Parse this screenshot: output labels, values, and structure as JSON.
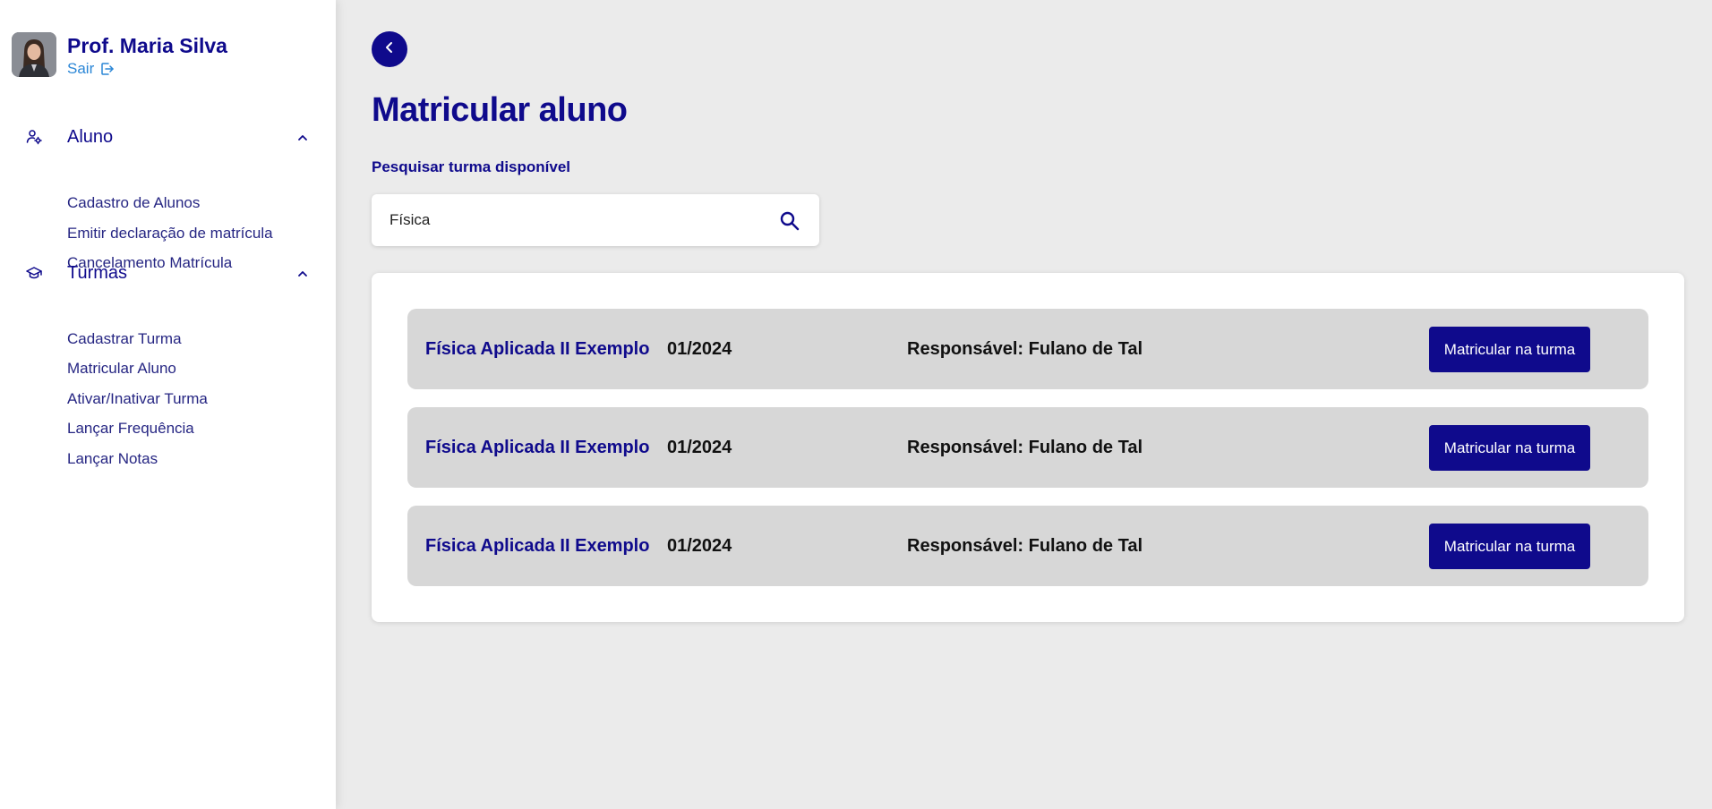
{
  "profile": {
    "name": "Prof. Maria Silva",
    "logout_label": "Sair",
    "avatar_icon": "avatar-photo",
    "logout_icon": "logout-icon"
  },
  "sidebar": {
    "sections": [
      {
        "label": "Aluno",
        "icon": "student-settings-icon",
        "expanded": true,
        "items": [
          {
            "label": "Cadastro de Alunos"
          },
          {
            "label": "Emitir declaração de matrícula"
          },
          {
            "label": "Cancelamento Matrícula"
          }
        ]
      },
      {
        "label": "Turmas",
        "icon": "graduation-cap-icon",
        "expanded": true,
        "items": [
          {
            "label": "Cadastrar Turma"
          },
          {
            "label": "Matricular Aluno"
          },
          {
            "label": "Ativar/Inativar Turma"
          },
          {
            "label": "Lançar Frequência"
          },
          {
            "label": "Lançar Notas"
          }
        ]
      }
    ]
  },
  "main": {
    "title": "Matricular aluno",
    "back_icon": "chevron-left-icon",
    "search": {
      "label": "Pesquisar turma disponível",
      "value": "Física",
      "placeholder": "",
      "icon": "search-icon"
    },
    "results": [
      {
        "name": "Física Aplicada II Exemplo",
        "period": "01/2024",
        "owner": "Responsável: Fulano de Tal",
        "action": "Matricular na turma"
      },
      {
        "name": "Física Aplicada II Exemplo",
        "period": "01/2024",
        "owner": "Responsável: Fulano de Tal",
        "action": "Matricular na turma"
      },
      {
        "name": "Física Aplicada II Exemplo",
        "period": "01/2024",
        "owner": "Responsável: Fulano de Tal",
        "action": "Matricular na turma"
      }
    ]
  },
  "colors": {
    "primary": "#0f0a8c",
    "link": "#2a86d6",
    "background": "#ebebeb",
    "row_background": "#d7d7d7",
    "card": "#ffffff"
  }
}
